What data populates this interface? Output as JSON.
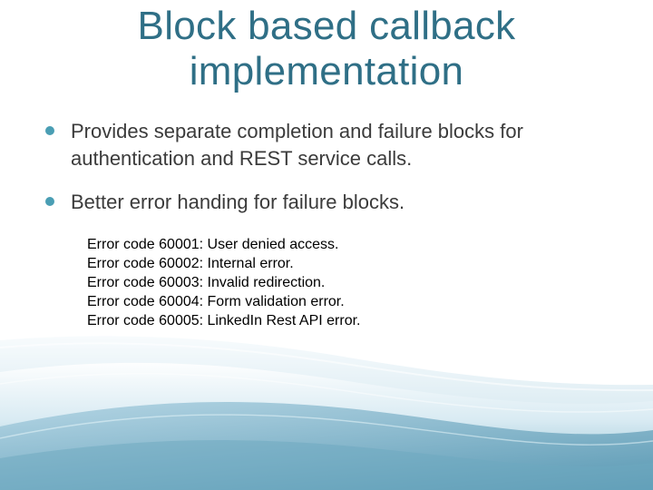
{
  "slide": {
    "title_lines": [
      "Block based callback",
      "implementation"
    ],
    "bullets": [
      {
        "lines": [
          "Provides separate completion and failure blocks for",
          "authentication and REST service calls."
        ]
      },
      {
        "lines": [
          "Better error handing for failure blocks."
        ]
      }
    ],
    "error_codes": [
      "Error code 60001: User denied access.",
      "Error code 60002: Internal error.",
      "Error code 60003: Invalid redirection.",
      "Error code 60004: Form validation error.",
      "Error code 60005: LinkedIn Rest API error."
    ]
  },
  "colors": {
    "title": "#2f6f86",
    "bullet_dot": "#4a9eb4",
    "wave_light": "#dcecf4",
    "wave_mid": "#9ec8da",
    "wave_dark": "#5f9fb9"
  }
}
